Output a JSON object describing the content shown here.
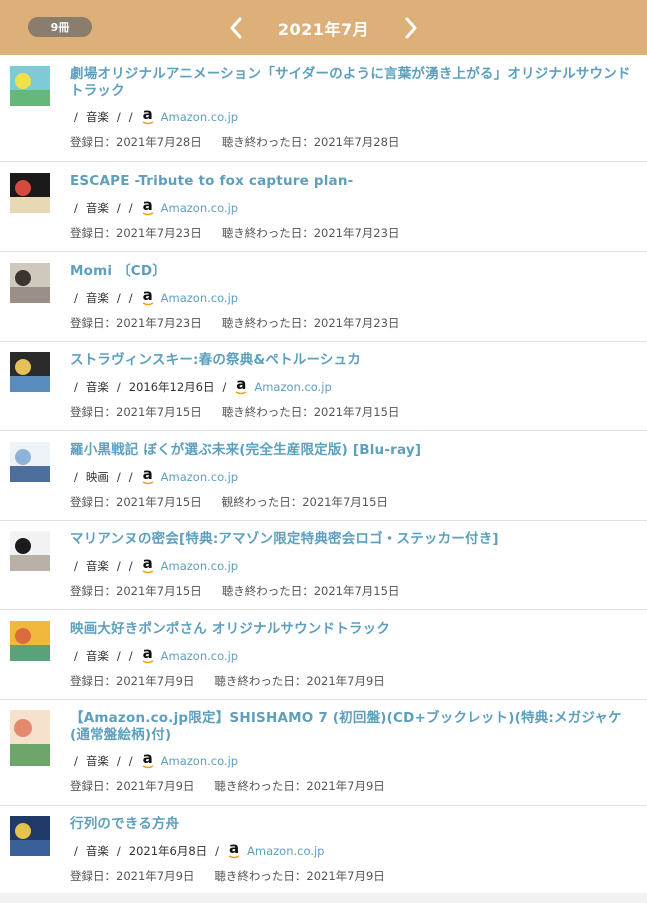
{
  "header": {
    "count_badge": "9冊",
    "month_title": "2021年7月",
    "prev_icon": "chevron-left-icon",
    "next_icon": "chevron-right-icon",
    "background": "#dcb078"
  },
  "labels": {
    "separator": "/",
    "amazon_glyph": "a",
    "amazon_link": "Amazon.co.jp"
  },
  "items": [
    {
      "title": "劇場オリジナルアニメーション「サイダーのように言葉が湧き上がる」オリジナルサウンドトラック",
      "category": "音楽",
      "release": "",
      "registered": "登録日：2021年7月28日",
      "finished": "聴き終わった日：2021年7月28日",
      "thumb_colors": [
        "#7ecbd8",
        "#f0e14a",
        "#66b87a"
      ]
    },
    {
      "title": "ESCAPE -Tribute to fox capture plan-",
      "category": "音楽",
      "release": "",
      "registered": "登録日：2021年7月23日",
      "finished": "聴き終わった日：2021年7月23日",
      "thumb_colors": [
        "#1a1a1a",
        "#d44a3c",
        "#e9d8b4"
      ]
    },
    {
      "title": "Momi 〔CD〕",
      "category": "音楽",
      "release": "",
      "registered": "登録日：2021年7月23日",
      "finished": "聴き終わった日：2021年7月23日",
      "thumb_colors": [
        "#cfc8bd",
        "#3a342f",
        "#9a8f86"
      ]
    },
    {
      "title": "ストラヴィンスキー:春の祭典&ペトルーシュカ",
      "category": "音楽",
      "release": "2016年12月6日",
      "registered": "登録日：2021年7月15日",
      "finished": "聴き終わった日：2021年7月15日",
      "thumb_colors": [
        "#2b2b2b",
        "#e3c25a",
        "#5a8bbf"
      ]
    },
    {
      "title": "羅小黒戦記 ぼくが選ぶ未来(完全生産限定版) [Blu-ray]",
      "category": "映画",
      "release": "",
      "registered": "登録日：2021年7月15日",
      "finished": "観終わった日：2021年7月15日",
      "thumb_colors": [
        "#eef3f8",
        "#8fb2d9",
        "#4c6f9e"
      ]
    },
    {
      "title": "マリアンヌの密会[特典:アマゾン限定特典密会ロゴ・ステッカー付き]",
      "category": "音楽",
      "release": "",
      "registered": "登録日：2021年7月15日",
      "finished": "聴き終わった日：2021年7月15日",
      "thumb_colors": [
        "#f2f2f2",
        "#1c1c1c",
        "#b9b1a8"
      ]
    },
    {
      "title": "映画大好きポンポさん オリジナルサウンドトラック",
      "category": "音楽",
      "release": "",
      "registered": "登録日：2021年7月9日",
      "finished": "聴き終わった日：2021年7月9日",
      "thumb_colors": [
        "#f1b93c",
        "#d96b3d",
        "#5aa37a"
      ]
    },
    {
      "title": "【Amazon.co.jp限定】SHISHAMO 7 (初回盤)(CD+ブックレット)(特典:メガジャケ(通常盤絵柄)付)",
      "category": "音楽",
      "release": "",
      "registered": "登録日：2021年7月9日",
      "finished": "聴き終わった日：2021年7月9日",
      "thumb_colors": [
        "#f6e2cc",
        "#e38a6e",
        "#6da56a"
      ]
    },
    {
      "title": "行列のできる方舟",
      "category": "音楽",
      "release": "2021年6月8日",
      "registered": "登録日：2021年7月9日",
      "finished": "聴き終わった日：2021年7月9日",
      "thumb_colors": [
        "#1f3a66",
        "#e6c44c",
        "#3b5f99"
      ]
    }
  ]
}
